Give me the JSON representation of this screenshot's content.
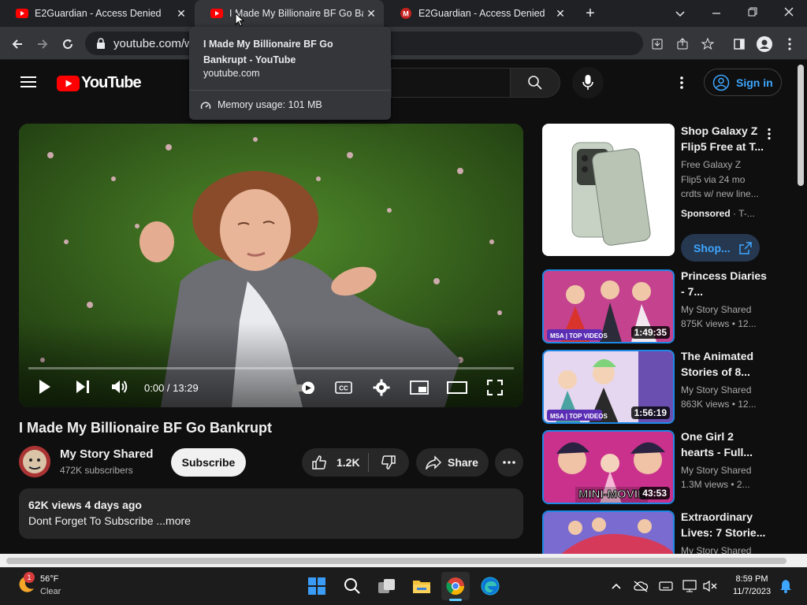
{
  "browser": {
    "tabs": [
      {
        "title": "E2Guardian - Access Denied",
        "favicon": "youtube-icon",
        "active": false
      },
      {
        "title": "I Made My Billionaire BF Go Bankrupt - YouTube",
        "favicon": "youtube-icon",
        "active": true
      },
      {
        "title": "E2Guardian - Access Denied",
        "favicon": "gmail-icon",
        "active": false
      }
    ],
    "new_tab": "+",
    "url": "youtube.com/w",
    "hovercard": {
      "title": "I Made My Billionaire BF Go Bankrupt - YouTube",
      "domain": "youtube.com",
      "memory": "Memory usage: 101 MB"
    }
  },
  "youtube": {
    "logo_text": "YouTube",
    "sign_in": "Sign in",
    "player": {
      "time": "0:00 / 13:29",
      "progress": 0
    },
    "video": {
      "title": "I Made My Billionaire BF Go Bankrupt",
      "channel": "My Story Shared",
      "subscribers": "472K subscribers",
      "subscribe_label": "Subscribe",
      "likes": "1.2K",
      "share_label": "Share",
      "views_date": "62K views  4 days ago",
      "description": "Dont Forget To Subscribe ...more"
    },
    "sidebar": {
      "ad": {
        "title": "Shop Galaxy Z Flip5 Free at T...",
        "desc": "Free Galaxy Z Flip5 via 24 mo crdts w/ new line...",
        "sponsored": "Sponsored",
        "advertiser": " · T-...",
        "cta": "Shop..."
      },
      "items": [
        {
          "title": "Princess Diaries - 7...",
          "channel": "My Story Shared",
          "meta": "875K views  • 12...",
          "duration": "1:49:35",
          "badge": "MSA | TOP VIDEOS"
        },
        {
          "title": "The Animated Stories of 8...",
          "channel": "My Story Shared",
          "meta": "863K views  • 12...",
          "duration": "1:56:19",
          "badge": "MSA | TOP VIDEOS"
        },
        {
          "title": "One Girl 2 hearts - Full...",
          "channel": "My Story Shared",
          "meta": "1.3M views  • 2...",
          "duration": "43:53",
          "badge": "MINI-MOVIE"
        },
        {
          "title": "Extraordinary Lives: 7 Storie...",
          "channel": "My Story Shared",
          "meta": "",
          "duration": "",
          "badge": ""
        }
      ]
    }
  },
  "taskbar": {
    "weather_temp": "56°F",
    "weather_desc": "Clear",
    "weather_badge": "1",
    "time": "8:59 PM",
    "date": "11/7/2023",
    "apps": [
      "windows-start-icon",
      "search-icon",
      "task-view-icon",
      "file-explorer-icon",
      "chrome-icon",
      "edge-icon"
    ]
  },
  "colors": {
    "yt_red": "#ff0000",
    "link_blue": "#3ea6ff",
    "bg": "#0f0f0f",
    "chrome_dark": "#202124"
  }
}
